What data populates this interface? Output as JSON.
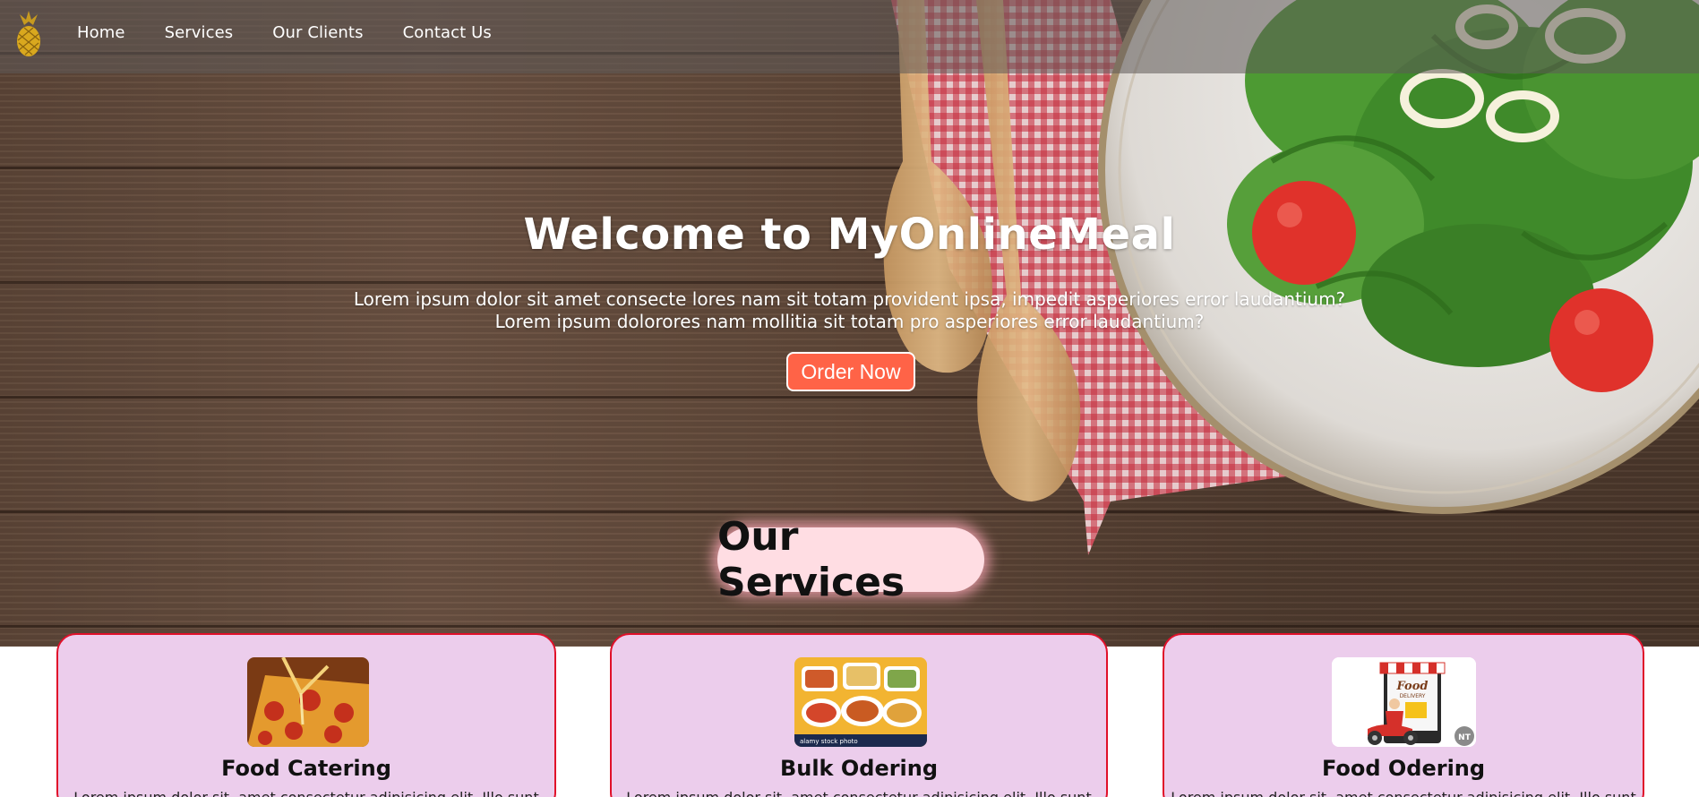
{
  "nav": {
    "logo": "pineapple-logo",
    "links": [
      "Home",
      "Services",
      "Our Clients",
      "Contact Us"
    ]
  },
  "hero": {
    "title": "Welcome to MyOnlineMeal",
    "subtitle_line1": "Lorem ipsum dolor sit amet consecte lores nam sit totam provident ipsa, impedit asperiores error laudantium?",
    "subtitle_line2": "Lorem ipsum dolorores nam mollitia sit totam pro asperiores error laudantium?",
    "cta_label": "Order Now"
  },
  "services": {
    "heading": "Our Services",
    "cards": [
      {
        "title": "Food Catering",
        "text": "Lorem ipsum dolor sit, amet consectetur adipisicing elit. Illo sunt",
        "image": "pizza-photo"
      },
      {
        "title": "Bulk Odering",
        "text": "Lorem ipsum dolor sit, amet consectetur adipisicing elit. Illo sunt",
        "image": "bulk-dishes-photo",
        "watermark": "alamy stock photo"
      },
      {
        "title": "Food Odering",
        "text": "Lorem ipsum dolor sit, amet consectetur adipisicing elit. Illo sunt",
        "image": "food-delivery-illustration",
        "sign": "Food DELIVERY"
      }
    ]
  },
  "colors": {
    "accent": "#ff6347",
    "card_bg": "#eccdec",
    "card_border": "#e0102a",
    "heading_bg": "#ffdde3"
  }
}
